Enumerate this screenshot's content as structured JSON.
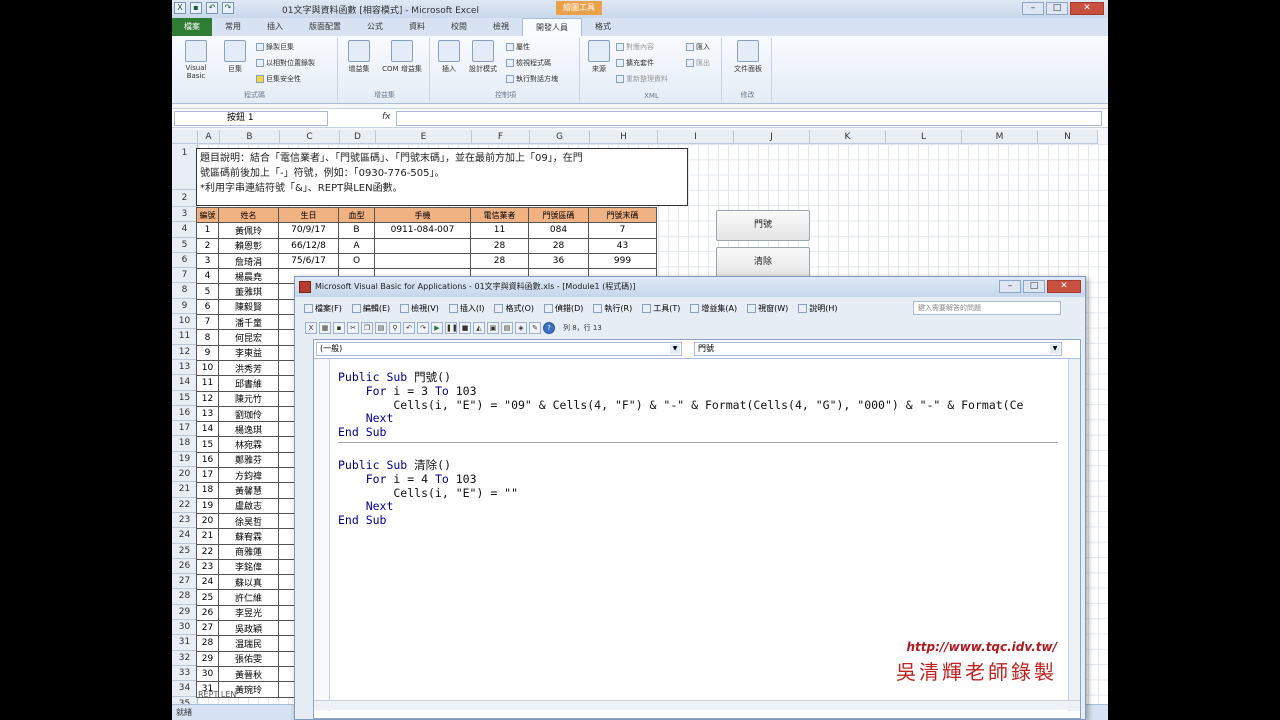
{
  "excel": {
    "title": "01文字與資料函數 [相容模式] - Microsoft Excel",
    "context_tab": "繪圖工具",
    "tabs": [
      "檔案",
      "常用",
      "插入",
      "版面配置",
      "公式",
      "資料",
      "校閱",
      "檢視",
      "開發人員",
      "格式"
    ],
    "active_tab_index": 8,
    "ribbon": {
      "code_group": {
        "name": "程式碼",
        "vb": "Visual Basic",
        "macro": "巨集",
        "record": "錄製巨集",
        "relative": "以相對位置錄製",
        "security": "巨集安全性"
      },
      "addins_group": {
        "name": "增益集",
        "addins": "增益集",
        "com": "COM 增益集"
      },
      "controls_group": {
        "name": "控制項",
        "insert": "插入",
        "design": "設計模式",
        "props": "屬性",
        "view_code": "檢視程式碼",
        "dialog": "執行對話方塊"
      },
      "xml_group": {
        "name": "XML",
        "source": "來源",
        "map": "對應內容",
        "expansion": "擴充套件",
        "refresh": "重新整理資料",
        "import": "匯入",
        "export": "匯出"
      },
      "modify_group": {
        "name": "修改",
        "doc_panel": "文件面板"
      }
    },
    "namebox": "按鈕 1",
    "fx": "fx",
    "columns": [
      "A",
      "B",
      "C",
      "D",
      "E",
      "F",
      "G",
      "H",
      "I",
      "J",
      "K",
      "L",
      "M",
      "N"
    ],
    "description": {
      "line1": "題目說明：結合「電信業者」、「門號區碼」、「門號末碼」，並在最前方加上「09」，在門",
      "line2": "號區碼前後加上「-」符號，例如：「0930-776-505」。",
      "line3": "*利用字串連結符號「&」、REPT與LEN函數。"
    },
    "table": {
      "headers": [
        "編號",
        "姓名",
        "生日",
        "血型",
        "手機",
        "電信業者",
        "門號區碼",
        "門號末碼"
      ],
      "rows": [
        [
          "1",
          "黃佩玲",
          "70/9/17",
          "B",
          "0911-084-007",
          "11",
          "084",
          "7"
        ],
        [
          "2",
          "賴恩彰",
          "66/12/8",
          "A",
          "",
          "28",
          "28",
          "43"
        ],
        [
          "3",
          "詹琦涓",
          "75/6/17",
          "O",
          "",
          "28",
          "36",
          "999"
        ],
        [
          "4",
          "楊晨堯",
          "",
          "",
          "",
          "",
          "",
          ""
        ],
        [
          "5",
          "董雅琪",
          "",
          "",
          "",
          "",
          "",
          ""
        ],
        [
          "6",
          "陳毅賢",
          "",
          "",
          "",
          "",
          "",
          ""
        ],
        [
          "7",
          "潘千童",
          "",
          "",
          "",
          "",
          "",
          ""
        ],
        [
          "8",
          "何昆宏",
          "",
          "",
          "",
          "",
          "",
          ""
        ],
        [
          "9",
          "李東益",
          "",
          "",
          "",
          "",
          "",
          ""
        ],
        [
          "10",
          "洪秀芳",
          "",
          "",
          "",
          "",
          "",
          ""
        ],
        [
          "11",
          "邱書維",
          "",
          "",
          "",
          "",
          "",
          ""
        ],
        [
          "12",
          "陳元竹",
          "",
          "",
          "",
          "",
          "",
          ""
        ],
        [
          "13",
          "劉珈伶",
          "",
          "",
          "",
          "",
          "",
          ""
        ],
        [
          "14",
          "楊逸琪",
          "",
          "",
          "",
          "",
          "",
          ""
        ],
        [
          "15",
          "林宛霖",
          "",
          "",
          "",
          "",
          "",
          ""
        ],
        [
          "16",
          "鄭雅芬",
          "",
          "",
          "",
          "",
          "",
          ""
        ],
        [
          "17",
          "方鈞禕",
          "",
          "",
          "",
          "",
          "",
          ""
        ],
        [
          "18",
          "黃馨慧",
          "",
          "",
          "",
          "",
          "",
          ""
        ],
        [
          "19",
          "盧啟志",
          "",
          "",
          "",
          "",
          "",
          ""
        ],
        [
          "20",
          "徐昊哲",
          "",
          "",
          "",
          "",
          "",
          ""
        ],
        [
          "21",
          "蘇宥霖",
          "",
          "",
          "",
          "",
          "",
          ""
        ],
        [
          "22",
          "商雅蓮",
          "",
          "",
          "",
          "",
          "",
          ""
        ],
        [
          "23",
          "李銘偉",
          "",
          "",
          "",
          "",
          "",
          ""
        ],
        [
          "24",
          "蘇以真",
          "",
          "",
          "",
          "",
          "",
          ""
        ],
        [
          "25",
          "許仁維",
          "",
          "",
          "",
          "",
          "",
          ""
        ],
        [
          "26",
          "李昱光",
          "",
          "",
          "",
          "",
          "",
          ""
        ],
        [
          "27",
          "吳政穎",
          "",
          "",
          "",
          "",
          "",
          ""
        ],
        [
          "28",
          "温瑞民",
          "",
          "",
          "",
          "",
          "",
          ""
        ],
        [
          "29",
          "張佑雯",
          "",
          "",
          "",
          "",
          "",
          ""
        ],
        [
          "30",
          "黃晉秋",
          "",
          "",
          "",
          "",
          "",
          ""
        ],
        [
          "31",
          "黃琬玲",
          "",
          "",
          "",
          "",
          "",
          ""
        ]
      ]
    },
    "buttons": {
      "menhao": "門號",
      "clear": "清除"
    },
    "sheet_tab": "REPT LEN",
    "status": "就緒"
  },
  "vbe": {
    "title": "Microsoft Visual Basic for Applications - 01文字與資料函數.xls - [Module1 (程式碼)]",
    "menu": [
      "檔案(F)",
      "編輯(E)",
      "檢視(V)",
      "插入(I)",
      "格式(O)",
      "偵錯(D)",
      "執行(R)",
      "工具(T)",
      "增益集(A)",
      "視窗(W)",
      "說明(H)"
    ],
    "search_placeholder": "鍵入需要解答的問題",
    "position": "列 8，行 13",
    "object_combo": "(一般)",
    "proc_combo": "門號",
    "code": {
      "p1": [
        "Public Sub 門號()",
        "    For i = 3 To 103",
        "        Cells(i, \"E\") = \"09\" & Cells(4, \"F\") & \"-\" & Format(Cells(4, \"G\"), \"000\") & \"-\" & Format(Ce",
        "    Next",
        "End Sub"
      ],
      "p2": [
        "Public Sub 清除()",
        "    For i = 4 To 103",
        "        Cells(i, \"E\") = \"\"",
        "    Next",
        "End Sub"
      ]
    }
  },
  "watermark": {
    "url": "http://www.tqc.idv.tw/",
    "signature": "吳清輝老師錄製"
  }
}
